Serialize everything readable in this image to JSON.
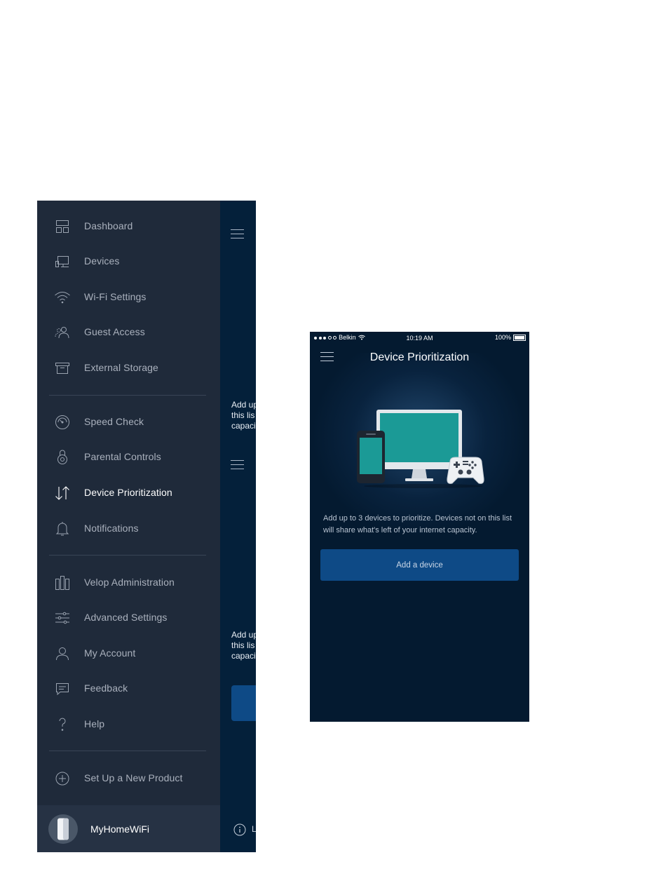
{
  "side_menu": {
    "items": [
      {
        "label": "Dashboard",
        "icon": "dashboard-icon"
      },
      {
        "label": "Devices",
        "icon": "devices-icon"
      },
      {
        "label": "Wi-Fi Settings",
        "icon": "wifi-icon"
      },
      {
        "label": "Guest Access",
        "icon": "guest-access-icon"
      },
      {
        "label": "External Storage",
        "icon": "storage-icon"
      },
      {
        "label": "Speed Check",
        "icon": "speedometer-icon"
      },
      {
        "label": "Parental Controls",
        "icon": "lock-icon"
      },
      {
        "label": "Device Prioritization",
        "icon": "priority-arrows-icon"
      },
      {
        "label": "Notifications",
        "icon": "bell-icon"
      },
      {
        "label": "Velop Administration",
        "icon": "velop-nodes-icon"
      },
      {
        "label": "Advanced Settings",
        "icon": "sliders-icon"
      },
      {
        "label": "My Account",
        "icon": "person-icon"
      },
      {
        "label": "Feedback",
        "icon": "chat-icon"
      },
      {
        "label": "Help",
        "icon": "question-icon"
      },
      {
        "label": "Set Up a New Product",
        "icon": "plus-circle-icon"
      }
    ],
    "active_item": "Device Prioritization",
    "network_name": "MyHomeWiFi"
  },
  "peek": {
    "text_lines": [
      "Add up",
      "this lis",
      "capaci"
    ],
    "text_lines_2": [
      "Add up",
      "this lis",
      "capaci"
    ],
    "info_letter": "L"
  },
  "phone": {
    "status": {
      "carrier": "Belkin",
      "time": "10:19 AM",
      "battery": "100%"
    },
    "title": "Device Prioritization",
    "description_lines": [
      "Add up to 3 devices to prioritize. Devices not on this list",
      "will share what's left of your internet capacity."
    ],
    "add_button_label": "Add a device"
  },
  "colors": {
    "menu_bg": "#1f2a3a",
    "screen_bg": "#04203a",
    "button_blue": "#0e4a86",
    "menu_text": "#aab1bd"
  }
}
